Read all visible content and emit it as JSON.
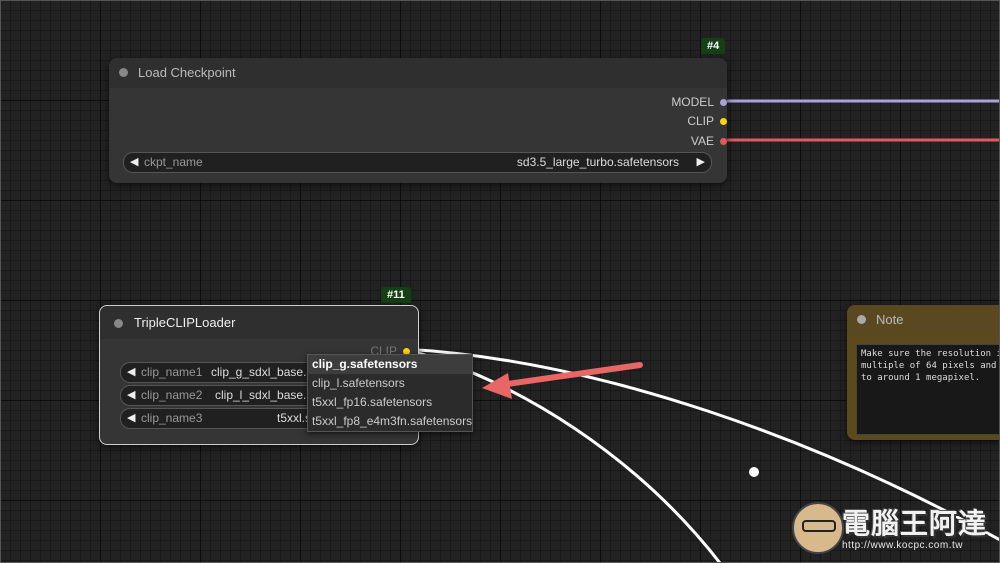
{
  "colors": {
    "model_link": "#a9a1d8",
    "clip_link": "#ffffff",
    "vae_link": "#e05a5a",
    "clip_slot": "#ffd500",
    "arrow": "#e86666",
    "badge_bg": "#154015"
  },
  "load_checkpoint": {
    "badge": "#4",
    "title": "Load Checkpoint",
    "outputs": {
      "model": "MODEL",
      "clip": "CLIP",
      "vae": "VAE"
    },
    "widget": {
      "name": "ckpt_name",
      "value": "sd3.5_large_turbo.safetensors"
    }
  },
  "triple_clip_loader": {
    "badge": "#11",
    "title": "TripleCLIPLoader",
    "output": "CLIP",
    "widgets": [
      {
        "name": "clip_name1",
        "value": "clip_g_sdxl_base.s"
      },
      {
        "name": "clip_name2",
        "value": "clip_l_sdxl_base.s"
      },
      {
        "name": "clip_name3",
        "value": "t5xxl.s"
      }
    ]
  },
  "dropdown_menu": {
    "items": [
      "clip_g.safetensors",
      "clip_l.safetensors",
      "t5xxl_fp16.safetensors",
      "t5xxl_fp8_e4m3fn.safetensors"
    ],
    "selected": "clip_g.safetensors"
  },
  "note_node": {
    "title": "Note",
    "text": "Make sure the resolution i\nmultiple of 64 pixels and\nto around 1 megapixel."
  },
  "watermark": {
    "title": "電腦王阿達",
    "url": "http://www.kocpc.com.tw"
  },
  "icons": {
    "left_arrow": "◀",
    "right_arrow": "▶"
  }
}
